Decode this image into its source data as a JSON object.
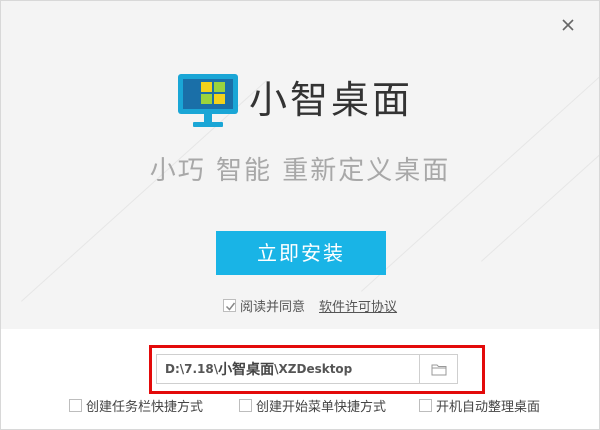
{
  "window": {
    "close_icon": "close-icon"
  },
  "brand": {
    "name": "小智桌面",
    "logo_icon": "monitor-logo-icon",
    "logo_colors": {
      "monitor": "#1aa6d6",
      "screen": "#1a6fa8",
      "tile_yellow": "#f2d21b",
      "tile_green": "#9bd33c"
    }
  },
  "slogan": "小巧 智能 重新定义桌面",
  "install_button": {
    "label": "立即安装",
    "color": "#19b4e6"
  },
  "agreement": {
    "checked": true,
    "text": "阅读并同意",
    "link_text": "软件许可协议"
  },
  "install_path": {
    "prefix": "D:\\7.18\\",
    "highlight": "小智桌面",
    "suffix": "\\XZDesktop",
    "browse_icon": "folder-icon",
    "highlight_border_color": "#e30a0a"
  },
  "options": [
    {
      "label": "创建任务栏快捷方式",
      "checked": false
    },
    {
      "label": "创建开始菜单快捷方式",
      "checked": false
    },
    {
      "label": "开机自动整理桌面",
      "checked": false
    }
  ]
}
